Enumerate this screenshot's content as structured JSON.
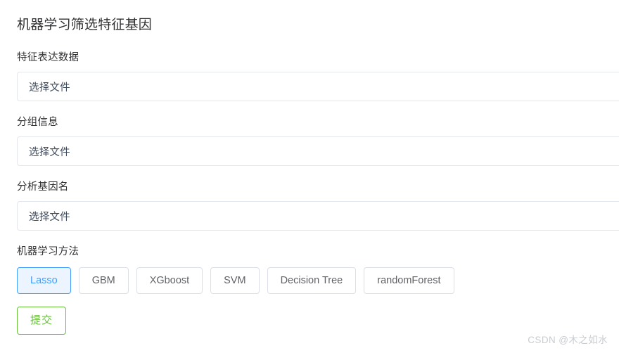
{
  "page": {
    "title": "机器学习筛选特征基因"
  },
  "fields": [
    {
      "label": "特征表达数据",
      "placeholder": "选择文件",
      "value": ""
    },
    {
      "label": "分组信息",
      "placeholder": "选择文件",
      "value": ""
    },
    {
      "label": "分析基因名",
      "placeholder": "选择文件",
      "value": ""
    }
  ],
  "methods": {
    "label": "机器学习方法",
    "selected": "Lasso",
    "options": [
      {
        "label": "Lasso",
        "selected": true
      },
      {
        "label": "GBM",
        "selected": false
      },
      {
        "label": "XGboost",
        "selected": false
      },
      {
        "label": "SVM",
        "selected": false
      },
      {
        "label": "Decision Tree",
        "selected": false
      },
      {
        "label": "randomForest",
        "selected": false
      }
    ]
  },
  "submit": {
    "label": "提交"
  },
  "watermark": {
    "text": "CSDN @木之如水"
  },
  "colors": {
    "accent_blue": "#409eff",
    "accent_blue_bg": "#ecf5ff",
    "success_green": "#67c23a",
    "border_gray": "#dcdfe6",
    "input_border": "#e4e7ed",
    "text_primary": "#303133",
    "text_regular": "#606266",
    "watermark_gray": "#c9ccd1"
  }
}
